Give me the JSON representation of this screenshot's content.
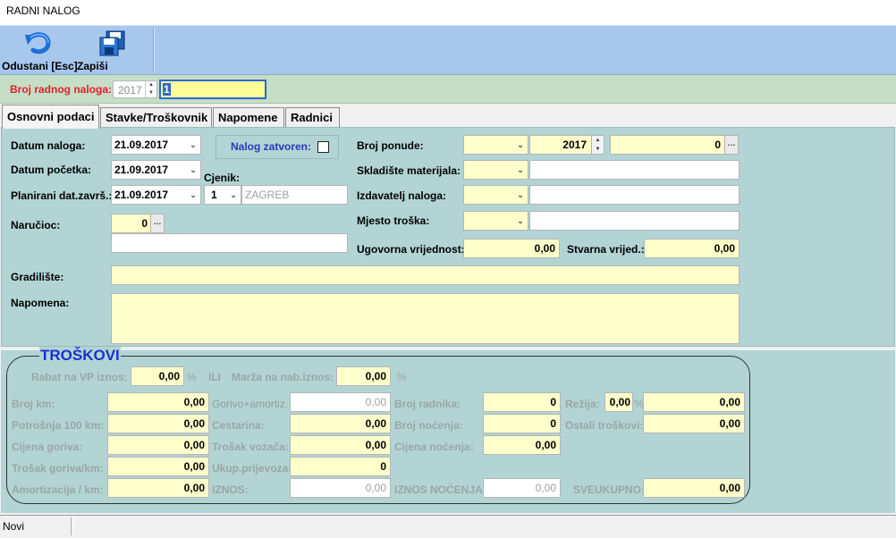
{
  "window": {
    "title": "RADNI NALOG"
  },
  "toolbar": {
    "cancel_label": "Odustani [Esc]",
    "save_label": "Zapiši"
  },
  "header": {
    "broj_label": "Broj radnog naloga:",
    "year": "2017",
    "broj_value": "1"
  },
  "tabs": [
    {
      "label": "Osnovni podaci",
      "active": true
    },
    {
      "label": "Stavke/Troškovnik",
      "active": false
    },
    {
      "label": "Napomene",
      "active": false
    },
    {
      "label": "Radnici",
      "active": false
    }
  ],
  "form": {
    "datum_naloga_label": "Datum naloga:",
    "datum_naloga": "21.09.2017",
    "datum_pocetka_label": "Datum početka:",
    "datum_pocetka": "21.09.2017",
    "planirani_label": "Planirani dat.završ.:",
    "planirani": "21.09.2017",
    "cjenik_label": "Cjenik:",
    "cjenik_value": "1",
    "cjenik_name": "ZAGREB",
    "narucioc_label": "Naručioc:",
    "narucioc_value": "0",
    "narucioc_name": "",
    "nalog_zatvoren_label": "Nalog zatvoren:",
    "broj_ponude_label": "Broj ponude:",
    "broj_ponude_type": "",
    "broj_ponude_year": "2017",
    "broj_ponude_num": "0",
    "skladiste_label": "Skladište materijala:",
    "skladiste_value": "",
    "skladiste_name": "",
    "izdavatelj_label": "Izdavatelj naloga:",
    "izdavatelj_value": "",
    "izdavatelj_name": "",
    "mjesto_label": "Mjesto troška:",
    "mjesto_value": "",
    "mjesto_name": "",
    "ugovorna_label": "Ugovorna vrijednost:",
    "ugovorna_value": "0,00",
    "stvarna_label": "Stvarna vrijed.:",
    "stvarna_value": "0,00",
    "gradiliste_label": "Gradilište:",
    "gradiliste_value": "",
    "napomena_label": "Napomena:",
    "napomena_value": ""
  },
  "troskovi": {
    "title": "TROŠKOVI",
    "rabat_label": "Rabat na VP iznos:",
    "rabat_value": "0,00",
    "percent": "%",
    "ili": "ILI",
    "marza_label": "Marža na nab.iznos:",
    "marza_value": "0,00",
    "broj_km_label": "Broj km:",
    "broj_km": "0,00",
    "potrosnja_label": "Potrošnja 100 km:",
    "potrosnja": "0,00",
    "cijena_goriva_label": "Cijena goriva:",
    "cijena_goriva": "0,00",
    "trosak_goriva_label": "Trošak goriva/km:",
    "trosak_goriva": "0,00",
    "amortizacija_label": "Amortizacija / km:",
    "amortizacija": "0,00",
    "gorivo_amort_label": "Gorivo+amortiz.",
    "gorivo_amort": "0,00",
    "cestarina_label": "Cestarina:",
    "cestarina": "0,00",
    "trosak_vozaca_label": "Trošak vozača:",
    "trosak_vozaca": "0,00",
    "ukup_prijevoza_label": "Ukup.prijevoza:",
    "ukup_prijevoza": "0",
    "iznos_label": "IZNOS:",
    "iznos": "0,00",
    "broj_radnika_label": "Broj radnika:",
    "broj_radnika": "0",
    "broj_nocenja_label": "Broj noćenja:",
    "broj_nocenja": "0",
    "cijena_nocenja_label": "Cijena noćenja:",
    "cijena_nocenja": "0,00",
    "iznos_nocenja_label": "IZNOS NOĆENJA:",
    "iznos_nocenja": "0,00",
    "rezija_label": "Režija:",
    "rezija_pct": "0,00",
    "rezija_value": "0,00",
    "ostali_label": "Ostali troškovi:",
    "ostali_value": "0,00",
    "sveukupno_label": "SVEUKUPNO:",
    "sveukupno_value": "0,00"
  },
  "status": {
    "mode": "Novi"
  }
}
